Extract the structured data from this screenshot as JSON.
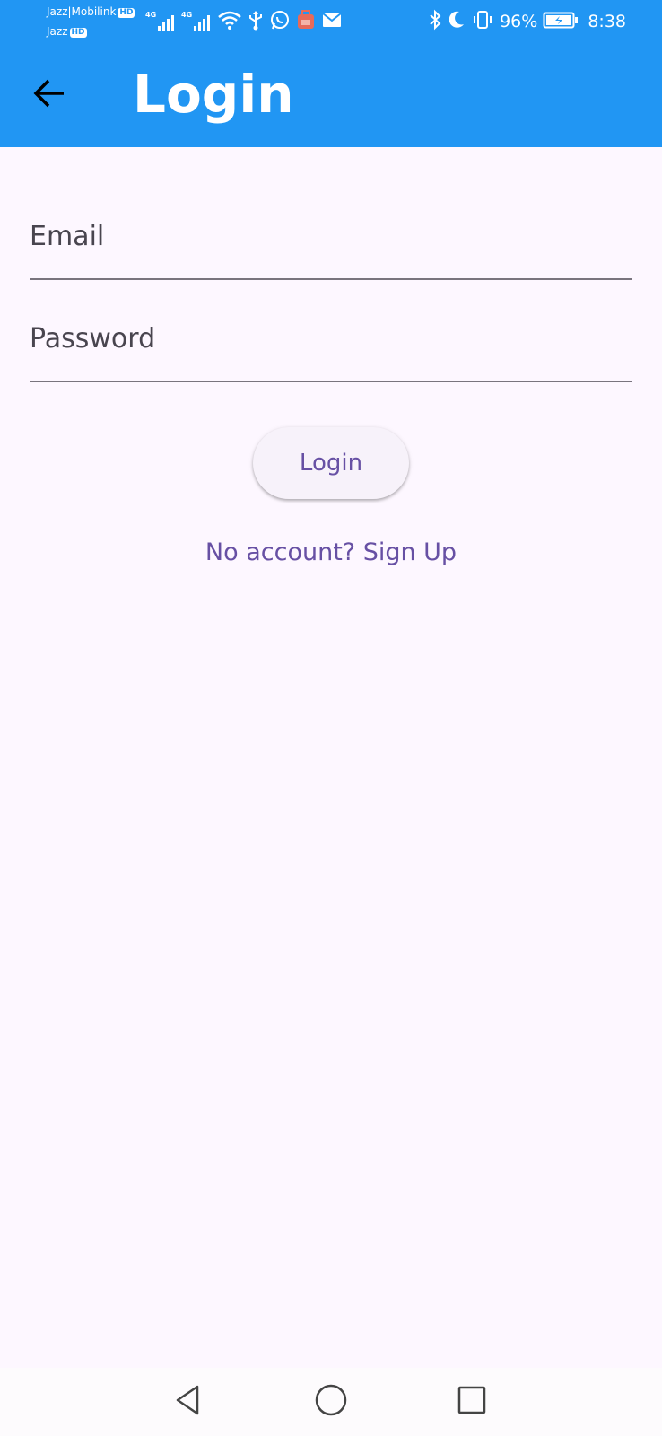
{
  "status_bar": {
    "carrier_primary": "Jazz|Mobilink",
    "carrier_secondary": "Jazz",
    "hd_badge": "HD",
    "network_type": "4G",
    "battery_percent": "96%",
    "time": "8:38",
    "icons": [
      "signal-icon",
      "signal-icon",
      "wifi-icon",
      "usb-icon",
      "whatsapp-icon",
      "notification-app-icon",
      "mail-icon",
      "bluetooth-icon",
      "do-not-disturb-icon",
      "vibrate-icon",
      "battery-charging-icon"
    ]
  },
  "app_bar": {
    "title": "Login",
    "back_icon": "arrow-back-icon"
  },
  "form": {
    "email_placeholder": "Email",
    "email_value": "",
    "password_placeholder": "Password",
    "password_value": ""
  },
  "actions": {
    "login_label": "Login",
    "signup_label": "No account? Sign Up"
  },
  "nav_bar": {
    "icons": [
      "back-triangle-icon",
      "home-circle-icon",
      "recents-square-icon"
    ]
  },
  "colors": {
    "app_bar": "#2196f3",
    "background": "#fdf7ff",
    "accent": "#6750a4",
    "field_line": "#79747e",
    "field_text": "#49454f"
  }
}
